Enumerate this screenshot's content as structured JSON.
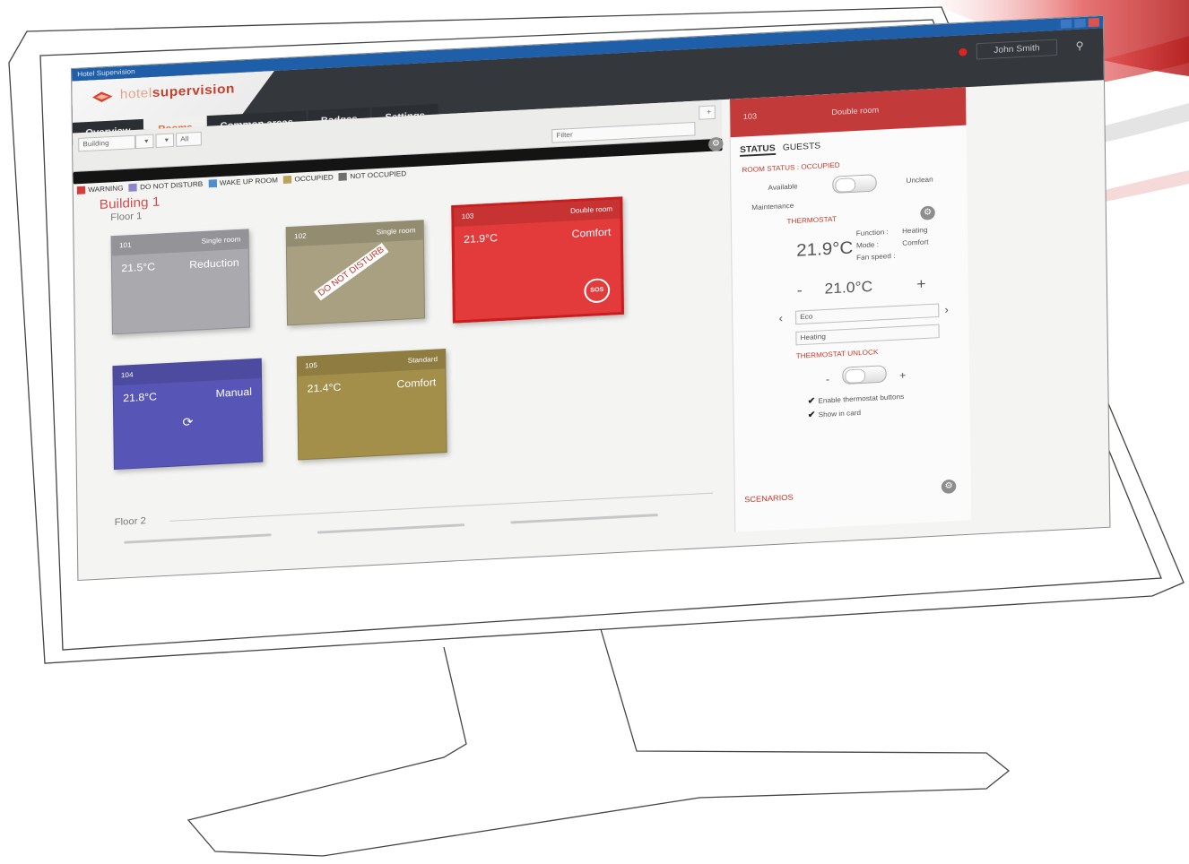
{
  "window": {
    "title": "Hotel Supervision"
  },
  "brand": {
    "part1": "hotel",
    "part2": "supervision"
  },
  "header": {
    "user_name": "John Smith"
  },
  "tabs": [
    {
      "label": "Overview"
    },
    {
      "label": "Rooms"
    },
    {
      "label": "Common areas"
    },
    {
      "label": "Badges"
    },
    {
      "label": "Settings"
    }
  ],
  "toolbar": {
    "building_select": "Building",
    "filter_select": "All",
    "search_placeholder": "Filter"
  },
  "legend": [
    {
      "label": "WARNING",
      "color": "#d23c3c"
    },
    {
      "label": "DO NOT DISTURB",
      "color": "#8e86c7"
    },
    {
      "label": "WAKE UP ROOM",
      "color": "#4b8fd1"
    },
    {
      "label": "OCCUPIED",
      "color": "#b9a45c"
    },
    {
      "label": "NOT OCCUPIED",
      "color": "#6f6f6f"
    }
  ],
  "building": {
    "name": "Building 1",
    "floor1": "Floor 1",
    "floor2": "Floor 2"
  },
  "rooms": [
    {
      "number": "101",
      "type": "Single room",
      "temp": "21.5°C",
      "mode": "Reduction",
      "color": "#a9a9ae"
    },
    {
      "number": "102",
      "type": "Single room",
      "status": "DO NOT DISTURB",
      "color": "#a8a081"
    },
    {
      "number": "103",
      "type": "Double room",
      "temp": "21.9°C",
      "mode": "Comfort",
      "color": "#e33b3b",
      "sos": "SOS"
    },
    {
      "number": "104",
      "type": "",
      "temp": "21.8°C",
      "mode": "Manual",
      "color": "#5756b6"
    },
    {
      "number": "105",
      "type": "Standard",
      "temp": "21.4°C",
      "mode": "Comfort",
      "color": "#a38e4a"
    }
  ],
  "panel": {
    "room": "103",
    "room_type": "Double room",
    "tab_status": "STATUS",
    "tab_guests": "GUESTS",
    "room_status": "ROOM STATUS : OCCUPIED",
    "toggle_left": "Available",
    "toggle_right": "Unclean",
    "maintenance": "Maintenance",
    "thermostat_label": "THERMOSTAT",
    "current_temp": "21.9°C",
    "function_label": "Function :",
    "function_value": "Heating",
    "mode_label": "Mode :",
    "mode_value": "Comfort",
    "fan_label": "Fan speed :",
    "setpoint": "21.0°C",
    "minus": "-",
    "plus": "+",
    "select_mode": "Eco",
    "select_function": "Heating",
    "thermostat_unlock": "THERMOSTAT UNLOCK",
    "unlock_left": "-",
    "unlock_right": "+",
    "check1": "Enable thermostat buttons",
    "check2": "Show in card",
    "scenarios": "SCENARIOS"
  }
}
